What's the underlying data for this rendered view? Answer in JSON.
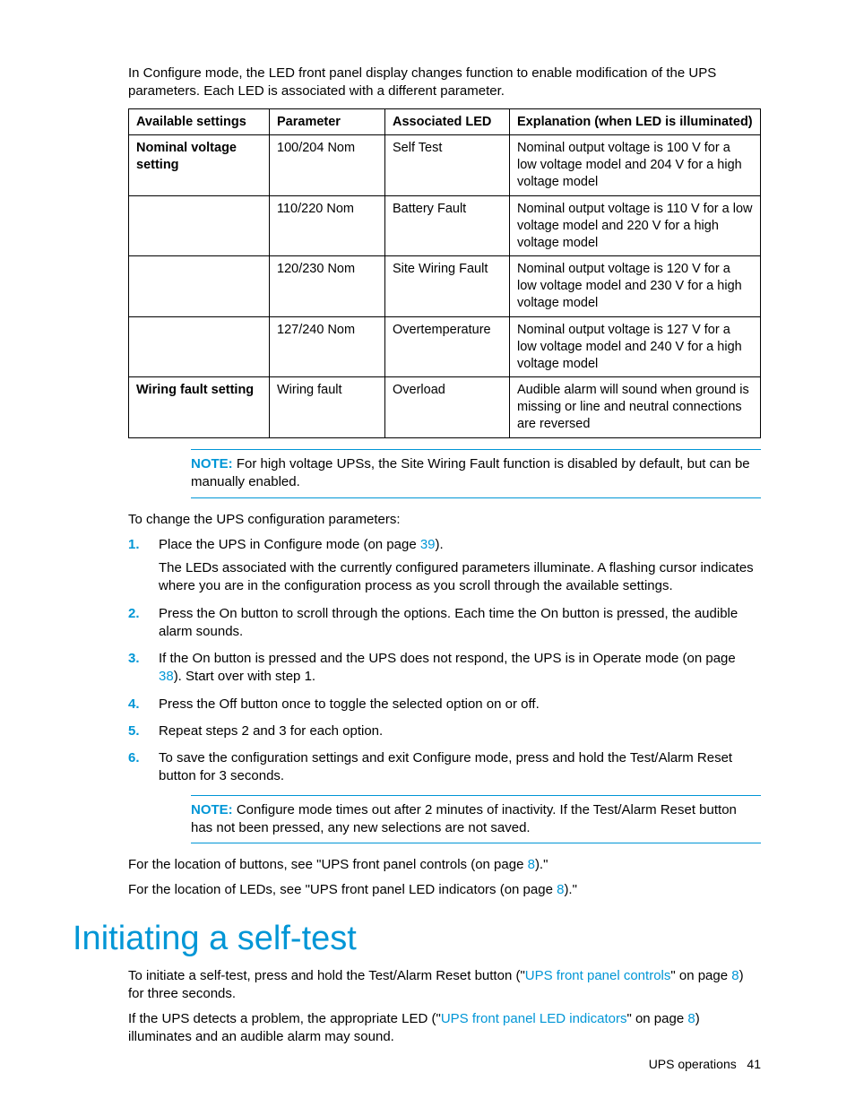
{
  "intro": "In Configure mode, the LED front panel display changes function to enable modification of the UPS parameters. Each LED is associated with a different parameter.",
  "table": {
    "headers": {
      "a": "Available settings",
      "b": "Parameter",
      "c": "Associated LED",
      "d": "Explanation (when LED is illuminated)"
    },
    "rows": [
      {
        "a": "Nominal voltage setting",
        "b": "100/204 Nom",
        "c": "Self Test",
        "d": "Nominal output voltage is 100 V for a low voltage model and 204 V for a high voltage model"
      },
      {
        "a": "",
        "b": "110/220 Nom",
        "c": "Battery Fault",
        "d": "Nominal output voltage is 110 V for a low voltage model and 220 V for a high voltage model"
      },
      {
        "a": "",
        "b": "120/230 Nom",
        "c": "Site Wiring Fault",
        "d": "Nominal output voltage is 120 V for a low voltage model and 230 V for a high voltage model"
      },
      {
        "a": "",
        "b": "127/240 Nom",
        "c": "Overtemperature",
        "d": "Nominal output voltage is 127 V for a low voltage model and 240 V for a high voltage model"
      },
      {
        "a": "Wiring fault setting",
        "b": "Wiring fault",
        "c": "Overload",
        "d": "Audible alarm will sound when ground is missing or line and neutral connections are reversed"
      }
    ]
  },
  "note1": {
    "label": "NOTE:",
    "text": "  For high voltage UPSs, the Site Wiring Fault function is disabled by default, but can be manually enabled."
  },
  "change_intro": "To change the UPS configuration parameters:",
  "steps": [
    {
      "pre": "Place the UPS in Configure mode (on page ",
      "link": "39",
      "post": ").",
      "sub": "The LEDs associated with the currently configured parameters illuminate. A flashing cursor indicates where you are in the configuration process as you scroll through the available settings."
    },
    {
      "text": "Press the On button to scroll through the options. Each time the On button is pressed, the audible alarm sounds."
    },
    {
      "pre": "If the On button is pressed and the UPS does not respond, the UPS is in Operate mode (on page ",
      "link": "38",
      "post": "). Start over with step 1."
    },
    {
      "text": "Press the Off button once to toggle the selected option on or off."
    },
    {
      "text": "Repeat steps 2 and 3 for each option."
    },
    {
      "text": "To save the configuration settings and exit Configure mode, press and hold the Test/Alarm Reset button for 3 seconds."
    }
  ],
  "note2": {
    "label": "NOTE:",
    "text": "  Configure mode times out after 2 minutes of inactivity. If the Test/Alarm Reset button has not been pressed, any new selections are not saved."
  },
  "loc1": {
    "pre": "For the location of buttons, see \"UPS front panel controls (on page ",
    "link": "8",
    "post": ").\""
  },
  "loc2": {
    "pre": "For the location of LEDs, see \"UPS front panel LED indicators (on page ",
    "link": "8",
    "post": ").\""
  },
  "section_heading": "Initiating a self-test",
  "selftest1": {
    "pre": "To initiate a self-test, press and hold the Test/Alarm Reset button (\"",
    "link1": "UPS front panel controls",
    "mid": "\" on page ",
    "link2": "8",
    "post": ") for three seconds."
  },
  "selftest2": {
    "pre": "If the UPS detects a problem, the appropriate LED (\"",
    "link1": "UPS front panel LED indicators",
    "mid": "\" on page ",
    "link2": "8",
    "post": ") illuminates and an audible alarm may sound."
  },
  "footer": {
    "section": "UPS operations",
    "page": "41"
  }
}
